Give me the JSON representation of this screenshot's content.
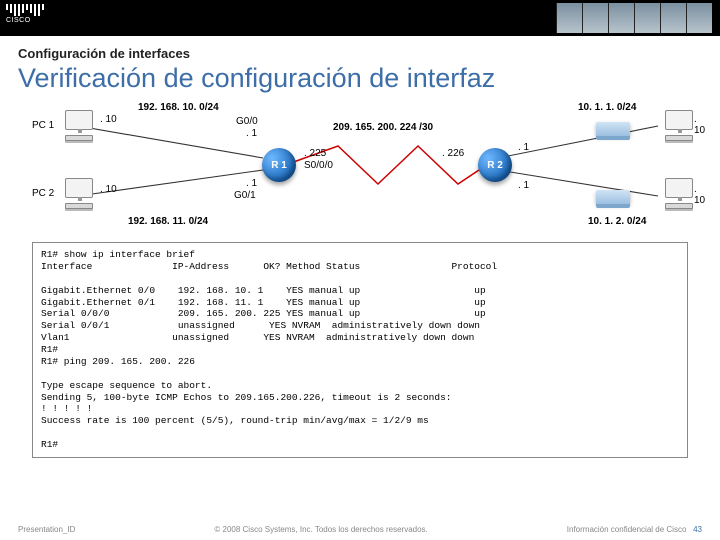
{
  "header": {
    "brand": "CISCO"
  },
  "kicker": "Configuración de interfaces",
  "title": "Verificación de configuración de interfaz",
  "nets": {
    "n1": "192. 168. 10. 0/24",
    "n2": "192. 168. 11. 0/24",
    "n3": "209. 165. 200. 224 /30",
    "n4": "10. 1. 1. 0/24",
    "n5": "10. 1. 2. 0/24"
  },
  "labels": {
    "pc1": "PC 1",
    "pc2": "PC 2",
    "r1": "R 1",
    "r2": "R 2",
    "g00": "G0/0",
    "g01": "G0/1",
    "s000": "S0/0/0",
    "dot10": ". 10",
    "dot1": ". 1",
    "dot225": ". 225",
    "dot226": ". 226"
  },
  "cli": "R1# show ip interface brief\nInterface              IP-Address      OK? Method Status                Protocol\n\nGigabit.Ethernet 0/0    192. 168. 10. 1    YES manual up                    up\nGigabit.Ethernet 0/1    192. 168. 11. 1    YES manual up                    up\nSerial 0/0/0            209. 165. 200. 225 YES manual up                    up\nSerial 0/0/1            unassigned      YES NVRAM  administratively down down\nVlan1                  unassigned      YES NVRAM  administratively down down\nR1#\nR1# ping 209. 165. 200. 226\n\nType escape sequence to abort.\nSending 5, 100-byte ICMP Echos to 209.165.200.226, timeout is 2 seconds:\n! ! ! ! !\nSuccess rate is 100 percent (5/5), round-trip min/avg/max = 1/2/9 ms\n\nR1#",
  "footer": {
    "left": "Presentation_ID",
    "center": "© 2008 Cisco Systems, Inc. Todos los derechos reservados.",
    "right": "Información confidencial de Cisco",
    "page": "43"
  }
}
